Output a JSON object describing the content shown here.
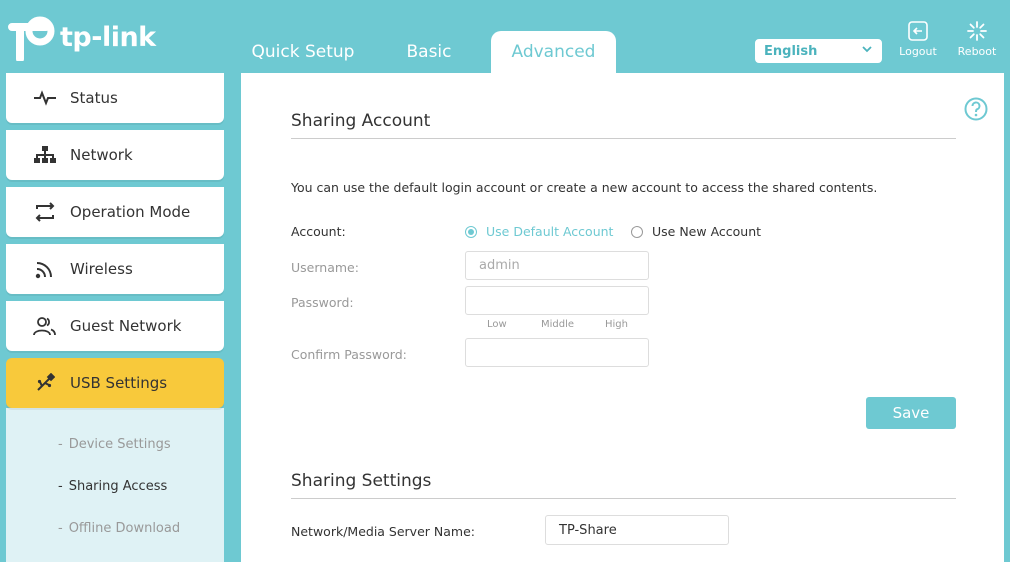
{
  "brand": {
    "name": "tp-link"
  },
  "tabs": [
    {
      "label": "Quick Setup"
    },
    {
      "label": "Basic"
    },
    {
      "label": "Advanced"
    }
  ],
  "language": {
    "selected": "English"
  },
  "tools": {
    "logout": "Logout",
    "reboot": "Reboot"
  },
  "sidebar": {
    "items": [
      {
        "label": "Status",
        "icon": "pulse-icon"
      },
      {
        "label": "Network",
        "icon": "network-icon"
      },
      {
        "label": "Operation Mode",
        "icon": "swap-icon"
      },
      {
        "label": "Wireless",
        "icon": "wifi-icon"
      },
      {
        "label": "Guest Network",
        "icon": "users-icon"
      },
      {
        "label": "USB Settings",
        "icon": "usb-icon"
      }
    ],
    "submenu": [
      {
        "label": "Device Settings"
      },
      {
        "label": "Sharing Access"
      },
      {
        "label": "Offline Download"
      }
    ]
  },
  "main": {
    "sharing_account": {
      "title": "Sharing Account",
      "description": "You can use the default login account or create a new account to access the shared contents.",
      "account_label": "Account:",
      "option_default": "Use Default Account",
      "option_new": "Use New Account",
      "username_label": "Username:",
      "username_value": "admin",
      "password_label": "Password:",
      "password_value": "",
      "strength": {
        "low": "Low",
        "middle": "Middle",
        "high": "High"
      },
      "confirm_label": "Confirm Password:",
      "confirm_value": "",
      "save_label": "Save"
    },
    "sharing_settings": {
      "title": "Sharing Settings",
      "server_name_label": "Network/Media Server Name:",
      "server_name_value": "TP-Share"
    }
  },
  "colors": {
    "accent": "#6ec9d2",
    "highlight": "#f8c93b",
    "submenu_bg": "#dff2f5"
  }
}
